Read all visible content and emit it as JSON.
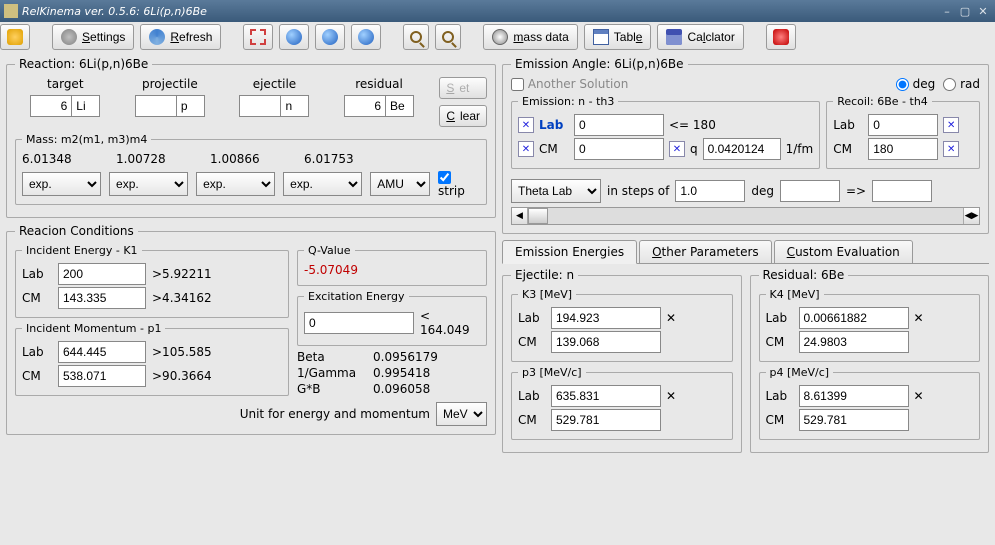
{
  "window": {
    "title": "RelKinema ver. 0.5.6: 6Li(p,n)6Be"
  },
  "toolbar": {
    "settings": "Settings",
    "refresh": "Refresh",
    "massdata": "mass data",
    "table": "Table",
    "calculator": "Calclator"
  },
  "reaction": {
    "legend": "Reaction: 6Li(p,n)6Be",
    "headers": {
      "target": "target",
      "projectile": "projectile",
      "ejectile": "ejectile",
      "residual": "residual"
    },
    "set": "Set",
    "clear": "Clear",
    "target_a": "6",
    "target_sym": "Li",
    "projectile_a": "",
    "projectile_sym": "p",
    "ejectile_a": "",
    "ejectile_sym": "n",
    "residual_a": "6",
    "residual_sym": "Be"
  },
  "mass": {
    "legend": "Mass: m2(m1, m3)m4",
    "m1": "6.01348",
    "m2": "1.00728",
    "m3": "1.00866",
    "m4": "6.01753",
    "src": "exp.",
    "unit": "AMU",
    "strip": "strip"
  },
  "conditions": {
    "legend": "Reacion Conditions",
    "incident_energy_legend": "Incident Energy - K1",
    "lab_label": "Lab",
    "cm_label": "CM",
    "ie_lab": "200",
    "ie_lab_gt": ">5.92211",
    "ie_cm": "143.335",
    "ie_cm_gt": ">4.34162",
    "incident_momentum_legend": "Incident Momentum - p1",
    "ip_lab": "644.445",
    "ip_lab_gt": ">105.585",
    "ip_cm": "538.071",
    "ip_cm_gt": ">90.3664",
    "qvalue_legend": "Q-Value",
    "qvalue": "-5.07049",
    "excitation_legend": "Excitation Energy",
    "excitation": "0",
    "excitation_lt": "< 164.049",
    "beta_label": "Beta",
    "beta": "0.0956179",
    "invgamma_label": "1/Gamma",
    "invgamma": "0.995418",
    "gb_label": "G*B",
    "gb": "0.096058",
    "unit_label": "Unit for energy and momentum",
    "unit": "MeV"
  },
  "emission": {
    "legend": "Emission Angle: 6Li(p,n)6Be",
    "another": "Another Solution",
    "deg": "deg",
    "rad": "rad",
    "emission_legend": "Emission: n - th3",
    "recoil_legend": "Recoil: 6Be - th4",
    "lab_label": "Lab",
    "cm_label": "CM",
    "em_lab": "0",
    "em_lab_le": "<= 180",
    "em_cm": "0",
    "q_label": "q",
    "q_val": "0.0420124",
    "q_unit": "1/fm",
    "rc_lab": "0",
    "rc_cm": "180",
    "theta_dropdown": "Theta Lab",
    "steps_label": "in steps of",
    "step_val": "1.0",
    "step_unit": "deg",
    "arrow": "=>"
  },
  "tabs": {
    "t1": "Emission Energies",
    "t2": "Other Parameters",
    "t3": "Custom Evaluation"
  },
  "ee": {
    "ejectile_legend": "Ejectile: n",
    "residual_legend": "Residual: 6Be",
    "k3_legend": "K3 [MeV]",
    "k4_legend": "K4 [MeV]",
    "p3_legend": "p3 [MeV/c]",
    "p4_legend": "p4 [MeV/c]",
    "lab": "Lab",
    "cm": "CM",
    "k3_lab": "194.923",
    "k3_cm": "139.068",
    "k4_lab": "0.00661882",
    "k4_cm": "24.9803",
    "p3_lab": "635.831",
    "p3_cm": "529.781",
    "p4_lab": "8.61399",
    "p4_cm": "529.781"
  }
}
